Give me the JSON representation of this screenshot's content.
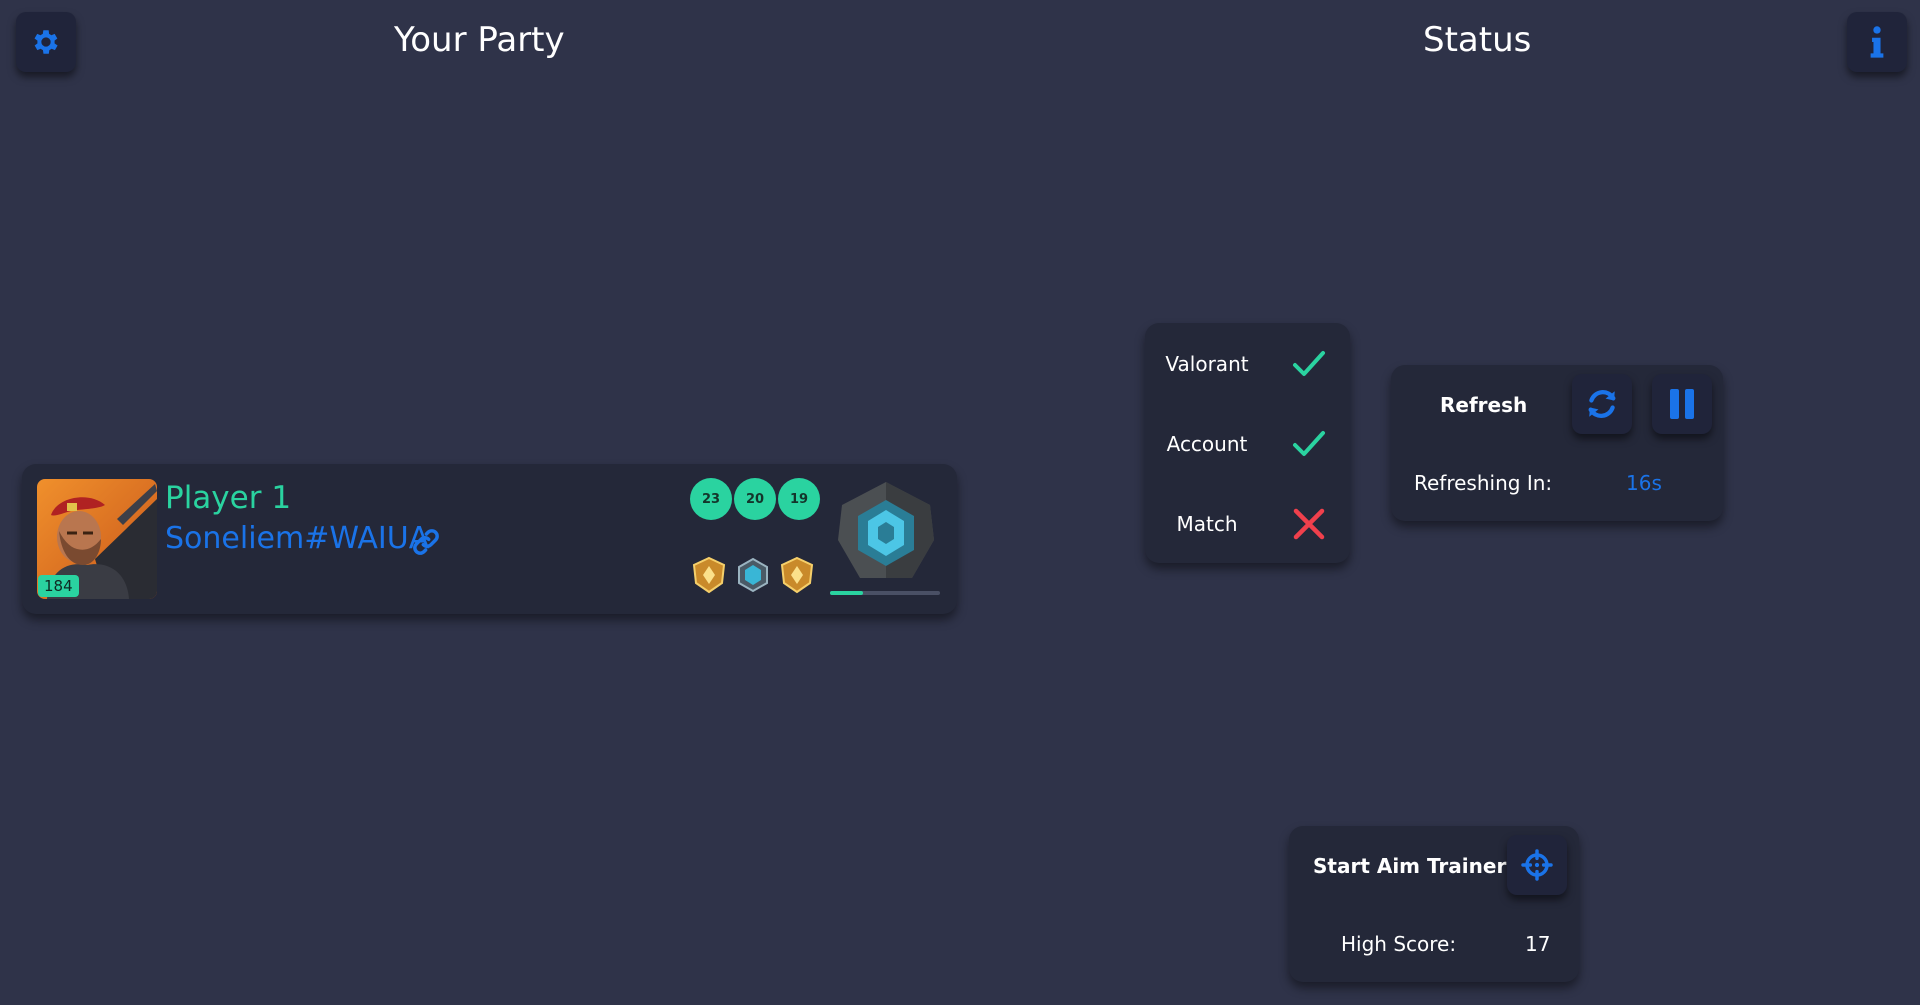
{
  "header": {
    "party_title": "Your Party",
    "status_title": "Status",
    "settings_icon": "gear-icon",
    "info_icon": "info-icon"
  },
  "party": {
    "players": [
      {
        "name": "Player 1",
        "riot_id": "Soneliem#WAIUA",
        "level": "184",
        "scores": [
          "23",
          "20",
          "19"
        ],
        "xp_progress": 0.3
      }
    ]
  },
  "status": {
    "items": [
      {
        "label": "Valorant",
        "ok": true
      },
      {
        "label": "Account",
        "ok": true
      },
      {
        "label": "Match",
        "ok": false
      }
    ]
  },
  "refresh": {
    "label": "Refresh",
    "refreshing_label": "Refreshing In:",
    "countdown": "16s"
  },
  "aim_trainer": {
    "label": "Start Aim Trainer",
    "high_score_label": "High Score:",
    "high_score": "17"
  },
  "colors": {
    "background": "#2f3349",
    "card": "#242839",
    "accent_teal": "#2ad3a0",
    "accent_blue": "#1a73e8",
    "error_red": "#f0404c"
  }
}
